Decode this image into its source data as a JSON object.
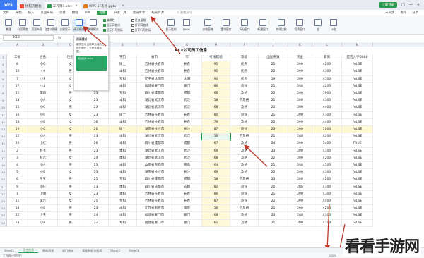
{
  "title_tabs": [
    {
      "label": "WPS",
      "color": "#3d7cf0"
    },
    {
      "label": "找稻壳模板",
      "color": "#e74c3c"
    },
    {
      "label": "工作簿1.xlsx",
      "color": "#2b9a4a"
    },
    {
      "label": "WPS 5F表格.pptx",
      "color": "#e67e22"
    }
  ],
  "title_right": {
    "login": "立即登录",
    "icons": [
      "□",
      "—",
      "✕"
    ]
  },
  "menus": [
    "文件",
    "开始",
    "插入",
    "页面布局",
    "公式",
    "数据",
    "审阅",
    "视图",
    "开发工具",
    "会员专享",
    "稻壳资源"
  ],
  "active_menu": "视图",
  "menu_search": "查找命令",
  "menu_right": [
    "未同步",
    "协作",
    "分享"
  ],
  "ribbon_buttons": [
    "普通",
    "分页预览",
    "页面布局",
    "自定义视图",
    "全屏显示",
    "阅读模式",
    "护眼模式"
  ],
  "ribbon_checks": [
    {
      "label": "编辑栏",
      "on": true
    },
    {
      "label": "显示网格线",
      "on": true
    },
    {
      "label": "显示行号列标",
      "on": true
    },
    {
      "label": "任务窗格",
      "on": false
    },
    {
      "label": "打印网格线",
      "on": false
    },
    {
      "label": "打印行号列标",
      "on": false
    }
  ],
  "ribbon_buttons2": [
    "显示比例",
    "100%",
    "冻结窗格",
    "重排窗口",
    "拆分窗口",
    "新建窗口",
    "并排比较",
    "切换窗口",
    "宏",
    "JS宏"
  ],
  "namebox": "K13",
  "fx": "fx",
  "popup": {
    "title": "阅读模式",
    "text": "高亮显示当前单元格所在的行和列，方便查看数据。",
    "img_text": "阅读模式 00:29"
  },
  "sheet_title": "XXX公司员工信息",
  "col_letters": [
    "A",
    "B",
    "C",
    "D",
    "E",
    "F",
    "G",
    "H",
    "I",
    "J",
    "K",
    "L",
    "M"
  ],
  "headers": [
    "工号",
    "姓名",
    "性别",
    "年龄",
    "学历",
    "省市",
    "市",
    "考核成绩",
    "等级",
    "出勤天数",
    "奖金",
    "薪资",
    "是否大于5000"
  ],
  "rows": [
    [
      "8",
      "小G",
      "女",
      "23",
      "硕士",
      "吉林省长春市",
      "长春",
      "91",
      "优秀",
      "21",
      "200",
      "4200",
      "FALSE"
    ],
    [
      "10",
      "小I",
      "男",
      "25",
      "本科",
      "吉林省长春市",
      "长春",
      "91",
      "优秀",
      "22",
      "200",
      "4300",
      "FALSE"
    ],
    [
      "7",
      "小F",
      "女",
      "23",
      "专科",
      "辽宁省沈阳市",
      "沈阳",
      "90",
      "优秀",
      "19",
      "200",
      "4100",
      "FALSE"
    ],
    [
      "17",
      "小L",
      "女",
      "22",
      "本科",
      "福建省厦门市",
      "厦门",
      "86",
      "良好",
      "21",
      "200",
      "4200",
      "FALSE"
    ],
    [
      "11",
      "李四",
      "男",
      "23",
      "专科",
      "四川省成都市",
      "成都",
      "66",
      "及格",
      "22",
      "200",
      "3900",
      "FALSE"
    ],
    [
      "13",
      "小A",
      "女",
      "23",
      "本科",
      "湖北省武汉市",
      "武汉",
      "58",
      "不及格",
      "21",
      "200",
      "4300",
      "FALSE"
    ],
    [
      "15",
      "小C",
      "男",
      "23",
      "本科",
      "湖北省武汉市",
      "武汉",
      "68",
      "及格",
      "22",
      "200",
      "4400",
      "FALSE"
    ],
    [
      "16",
      "小R",
      "女",
      "23",
      "硕士",
      "吉林省长春市",
      "长春",
      "80",
      "良好",
      "21",
      "200",
      "4100",
      "FALSE"
    ],
    [
      "18",
      "小B",
      "女",
      "36",
      "本科",
      "吉林省长春市",
      "长春",
      "79",
      "及格",
      "22",
      "200",
      "4400",
      "FALSE"
    ],
    [
      "19",
      "小C",
      "女",
      "26",
      "硕士",
      "湖南省长沙市",
      "长沙",
      "87",
      "良好",
      "23",
      "200",
      "5000",
      "FALSE"
    ],
    [
      "12",
      "小A",
      "男",
      "23",
      "本科",
      "湖北省武汉市",
      "武汉",
      "56",
      "不及格",
      "21",
      "200",
      "4200",
      "FALSE"
    ],
    [
      "20",
      "小红",
      "男",
      "26",
      "本科",
      "四川省成都市",
      "成都",
      "67",
      "及格",
      "24",
      "200",
      "5400",
      "TRUE"
    ],
    [
      "2",
      "赵七",
      "男",
      "23",
      "本科",
      "湖北省武汉市",
      "武汉",
      "69",
      "及格",
      "23",
      "200",
      "4100",
      "FALSE"
    ],
    [
      "3",
      "赵六",
      "女",
      "24",
      "本科",
      "湖北省武汉市",
      "武汉",
      "68",
      "及格",
      "22",
      "200",
      "4200",
      "FALSE"
    ],
    [
      "4",
      "小A",
      "男",
      "23",
      "本科",
      "山东省青岛市",
      "青岛",
      "64",
      "及格",
      "21",
      "200",
      "4100",
      "FALSE"
    ],
    [
      "5",
      "小B",
      "女",
      "23",
      "本科",
      "湖南省长沙市",
      "长沙",
      "69",
      "及格",
      "22",
      "200",
      "4300",
      "FALSE"
    ],
    [
      "6",
      "王五",
      "男",
      "25",
      "专科",
      "四川省成都市",
      "成都",
      "58",
      "不及格",
      "23",
      "200",
      "4200",
      "FALSE"
    ],
    [
      "9",
      "小H",
      "男",
      "23",
      "本科",
      "四川省成都市",
      "成都",
      "82",
      "良好",
      "20",
      "200",
      "4300",
      "FALSE"
    ],
    [
      "1",
      "小明",
      "女",
      "23",
      "本科",
      "吉林省长春市",
      "长春",
      "86",
      "良好",
      "21",
      "200",
      "4300",
      "FALSE"
    ],
    [
      "21",
      "李六",
      "女",
      "25",
      "专科",
      "吉林省长春市",
      "长春",
      "87",
      "良好",
      "22",
      "200",
      "4400",
      "FALSE"
    ],
    [
      "14",
      "小B",
      "男",
      "23",
      "本科",
      "江苏省南京市",
      "南京",
      "56",
      "不及格",
      "21",
      "200",
      "4200",
      "FALSE"
    ],
    [
      "22",
      "小王",
      "男",
      "24",
      "本科",
      "福建省厦门市",
      "厦门",
      "68",
      "及格",
      "23",
      "200",
      "4300",
      "FALSE"
    ],
    [
      "23",
      "小E",
      "男",
      "22",
      "专科",
      "福建省厦门市",
      "厦门",
      "61",
      "及格",
      "21",
      "200",
      "4100",
      "FALSE"
    ]
  ],
  "highlight_row_index": 9,
  "selected_cell": {
    "row": 10,
    "col": 7
  },
  "sheet_tabs": [
    "Sheet1",
    "员工信息",
    "数据透视",
    "部门统计",
    "基础数据分析表",
    "Sheet2",
    "Sheet3"
  ],
  "active_sheet": "员工信息",
  "status_left": "工作表已受保护",
  "status_right": "100%",
  "watermark": "看看手游网"
}
